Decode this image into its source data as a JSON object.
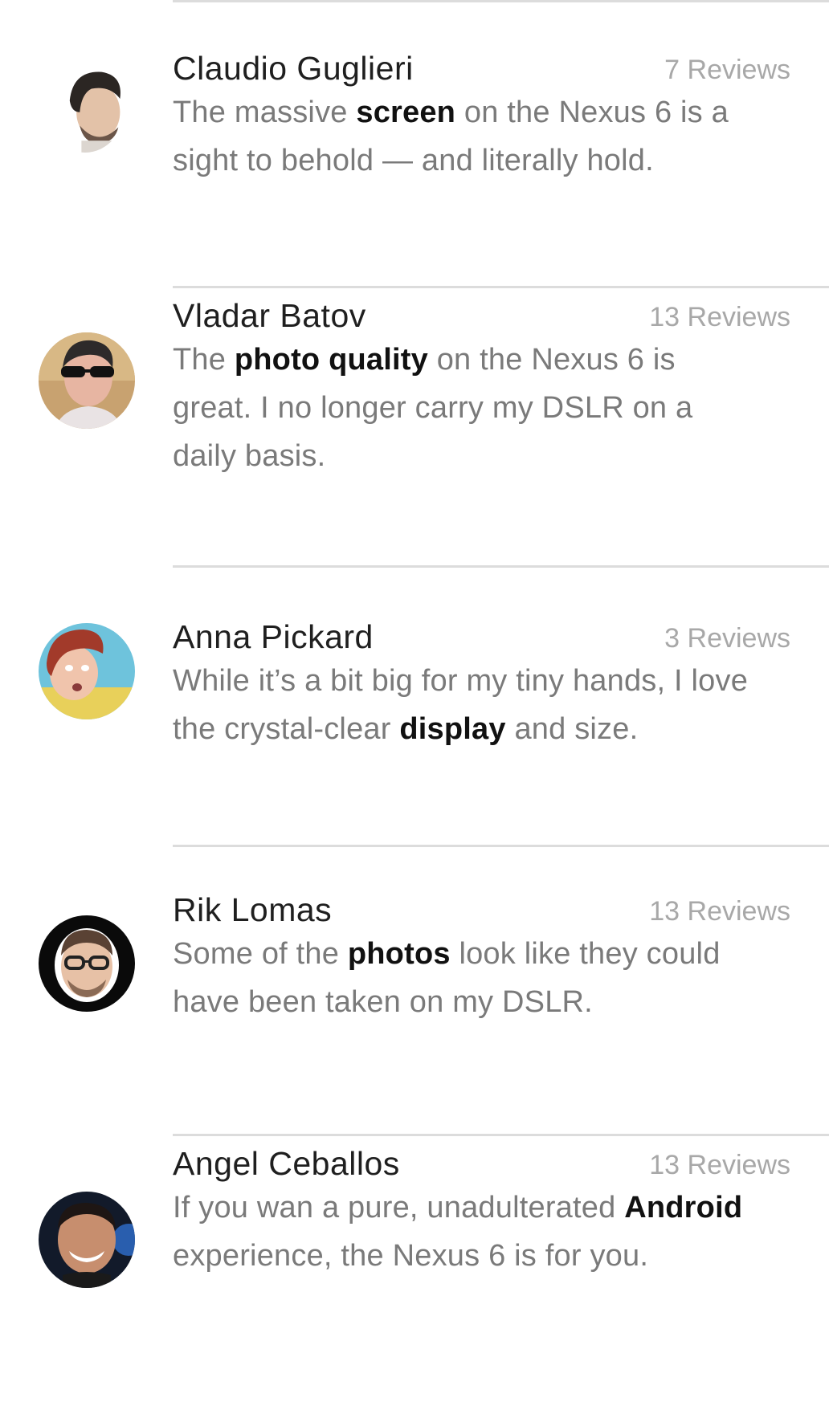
{
  "reviews": [
    {
      "name": "Claudio Guglieri",
      "count": "7 Reviews",
      "text_before": "The massive ",
      "highlight": "screen",
      "text_after": " on the Nexus 6 is a sight to behold — and literally hold.",
      "avatar_icon": "avatar-man-beard"
    },
    {
      "name": "Vladar Batov",
      "count": "13 Reviews",
      "text_before": "The ",
      "highlight": "photo quality",
      "text_after": " on the Nexus 6 is great. I no longer carry my DSLR on a daily basis.",
      "avatar_icon": "avatar-man-sunglasses"
    },
    {
      "name": "Anna Pickard",
      "count": "3 Reviews",
      "text_before": "While it’s a bit big for my tiny hands, I love the crystal-clear ",
      "highlight": "display",
      "text_after": " and size.",
      "avatar_icon": "avatar-woman-red-hair"
    },
    {
      "name": "Rik Lomas",
      "count": "13 Reviews",
      "text_before": "Some of the ",
      "highlight": "photos",
      "text_after": " look like they could have been taken on my DSLR.",
      "avatar_icon": "avatar-man-glasses"
    },
    {
      "name": "Angel Ceballos",
      "count": "13 Reviews",
      "text_before": "If you wan a pure, unadulterated ",
      "highlight": "Android",
      "text_after": " experience, the Nexus 6 is for you.",
      "avatar_icon": "avatar-man-smiling"
    }
  ]
}
